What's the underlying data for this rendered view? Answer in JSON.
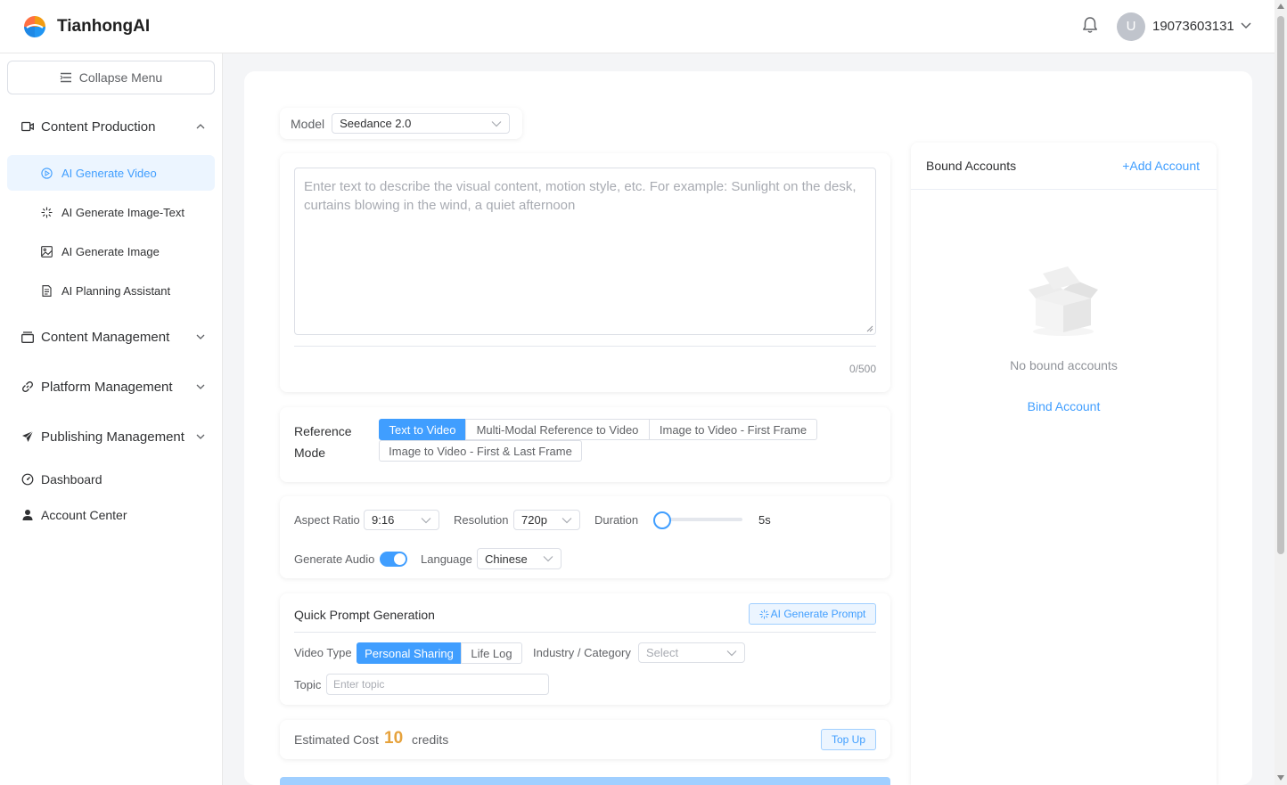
{
  "header": {
    "brand": "TianhongAI",
    "avatar_letter": "U",
    "username": "19073603131"
  },
  "sidebar": {
    "collapse_label": "Collapse Menu",
    "groups": [
      {
        "label": "Content Production",
        "icon": "video-camera-icon",
        "expanded": true,
        "items": [
          {
            "label": "AI Generate Video",
            "icon": "play-circle-icon",
            "active": true
          },
          {
            "label": "AI Generate Image-Text",
            "icon": "sparkle-icon"
          },
          {
            "label": "AI Generate Image",
            "icon": "image-icon"
          },
          {
            "label": "AI Planning Assistant",
            "icon": "document-icon"
          }
        ]
      },
      {
        "label": "Content Management",
        "icon": "archive-icon",
        "expanded": false
      },
      {
        "label": "Platform Management",
        "icon": "link-icon",
        "expanded": false
      },
      {
        "label": "Publishing Management",
        "icon": "paper-plane-icon",
        "expanded": false
      }
    ],
    "dashboard": "Dashboard",
    "account_center": "Account Center"
  },
  "form": {
    "model_label": "Model",
    "model_value": "Seedance 2.0",
    "prompt_placeholder": "Enter text to describe the visual content, motion style, etc. For example: Sunlight on the desk, curtains blowing in the wind, a quiet afternoon",
    "prompt_counter": "0/500",
    "reference_mode_label_1": "Reference",
    "reference_mode_label_2": "Mode",
    "reference_modes": [
      "Text to Video",
      "Multi-Modal Reference to Video",
      "Image to Video - First Frame",
      "Image to Video - First & Last Frame"
    ],
    "reference_mode_selected": "Text to Video",
    "aspect_ratio_label": "Aspect Ratio",
    "aspect_ratio_value": "9:16",
    "resolution_label": "Resolution",
    "resolution_value": "720p",
    "duration_label": "Duration",
    "duration_value": "5s",
    "generate_audio_label": "Generate Audio",
    "generate_audio_on": true,
    "language_label": "Language",
    "language_value": "Chinese"
  },
  "quick_prompt": {
    "title": "Quick Prompt Generation",
    "ai_button": "AI Generate Prompt",
    "video_type_label": "Video Type",
    "video_types": [
      "Personal Sharing",
      "Life Log"
    ],
    "video_type_selected": "Personal Sharing",
    "industry_label": "Industry / Category",
    "industry_placeholder": "Select",
    "topic_label": "Topic",
    "topic_placeholder": "Enter topic"
  },
  "cost": {
    "label": "Estimated Cost",
    "value": "10",
    "unit": "credits",
    "topup_button": "Top Up"
  },
  "accounts": {
    "title": "Bound Accounts",
    "add_button": "Add Account",
    "empty_text": "No bound accounts",
    "bind_link": "Bind Account"
  },
  "colors": {
    "accent": "#409eff",
    "accent_light": "#ecf5ff",
    "cost_highlight": "#e6a23c"
  }
}
